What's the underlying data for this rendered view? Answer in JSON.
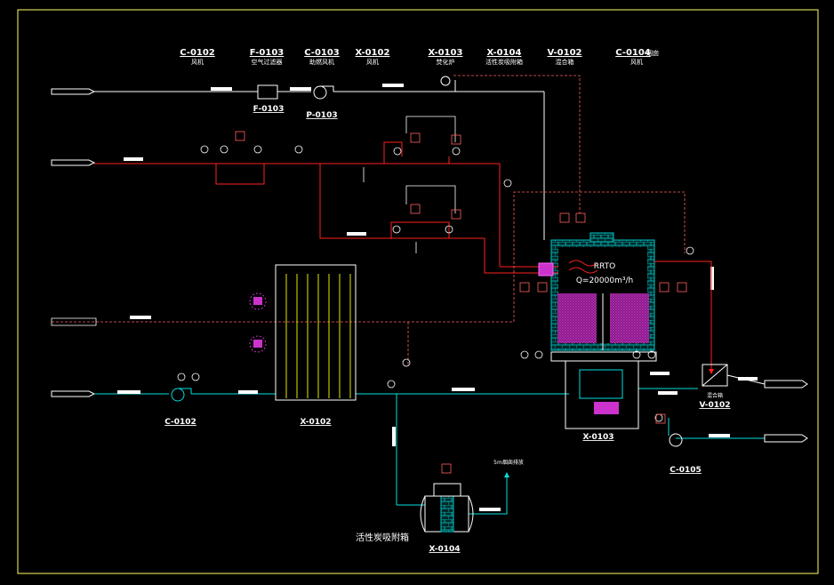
{
  "header": {
    "columns": [
      {
        "tag": "C-0102",
        "name": "风机"
      },
      {
        "tag": "F-0103",
        "name": "空气过滤器"
      },
      {
        "tag": "C-0103",
        "name": "助燃风机"
      },
      {
        "tag": "X-0102",
        "name": "风机"
      },
      {
        "tag": "X-0103",
        "name": "焚化炉"
      },
      {
        "tag": "X-0104",
        "name": "活性炭吸附箱"
      },
      {
        "tag": "V-0102",
        "name": "混合箱"
      },
      {
        "tag": "C-0104",
        "name": "风机",
        "suffix": "烟囱"
      }
    ]
  },
  "equipment": {
    "f0103": "F-0103",
    "p0103": "P-0103",
    "c0102": "C-0102",
    "x0102": "X-0102",
    "x0103": "X-0103",
    "v0102": "V-0102",
    "v0102_name": "混合箱",
    "c0105": "C-0105",
    "x0104": "X-0104",
    "x0104_name": "活性炭吸附箱"
  },
  "rrto": {
    "name": "RRTO",
    "capacity": "Q=20000m³/h"
  },
  "annotations": {
    "exhaust": "5m烟囱排放"
  },
  "colors": {
    "air_line": "#ffffff",
    "gas_line": "#ff2020",
    "waste_line": "#00e0e0",
    "signal_line": "#ff6060",
    "media": "#cc33cc",
    "insulation": "#00c8c8",
    "frame": "#ffff66"
  }
}
